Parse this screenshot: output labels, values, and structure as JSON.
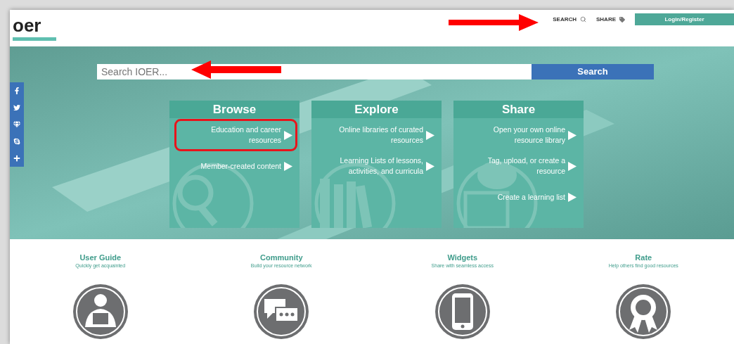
{
  "header": {
    "logo": "oer",
    "nav": [
      {
        "label": "SEARCH",
        "kind": "search"
      },
      {
        "label": "SHARE",
        "kind": "tag"
      }
    ],
    "login_button": "Login/Register"
  },
  "search": {
    "placeholder": "Search IOER...",
    "button": "Search"
  },
  "social": [
    {
      "kind": "facebook"
    },
    {
      "kind": "twitter"
    },
    {
      "kind": "gem"
    },
    {
      "kind": "skype"
    },
    {
      "kind": "plus"
    }
  ],
  "cards": [
    {
      "title": "Browse",
      "kind": "magnifier",
      "items": [
        {
          "label": "Education and career resources",
          "highlighted": true
        },
        {
          "label": "Member-created content",
          "highlighted": false
        }
      ]
    },
    {
      "title": "Explore",
      "kind": "books",
      "items": [
        {
          "label": "Online libraries of curated resources",
          "highlighted": false
        },
        {
          "label": "Learning Lists of lessons, activities, and curricula",
          "highlighted": false
        }
      ]
    },
    {
      "title": "Share",
      "kind": "tablet",
      "items": [
        {
          "label": "Open your own online resource library",
          "highlighted": false
        },
        {
          "label": "Tag, upload, or create a resource",
          "highlighted": false
        },
        {
          "label": "Create a learning list",
          "highlighted": false
        }
      ]
    }
  ],
  "features": [
    {
      "title": "User Guide",
      "subtitle": "Quickly get acquainted",
      "kind": "reader"
    },
    {
      "title": "Community",
      "subtitle": "Build your resource network",
      "kind": "chat"
    },
    {
      "title": "Widgets",
      "subtitle": "Share with seamless access",
      "kind": "tablet"
    },
    {
      "title": "Rate",
      "subtitle": "Help others find good resources",
      "kind": "ribbon"
    }
  ]
}
